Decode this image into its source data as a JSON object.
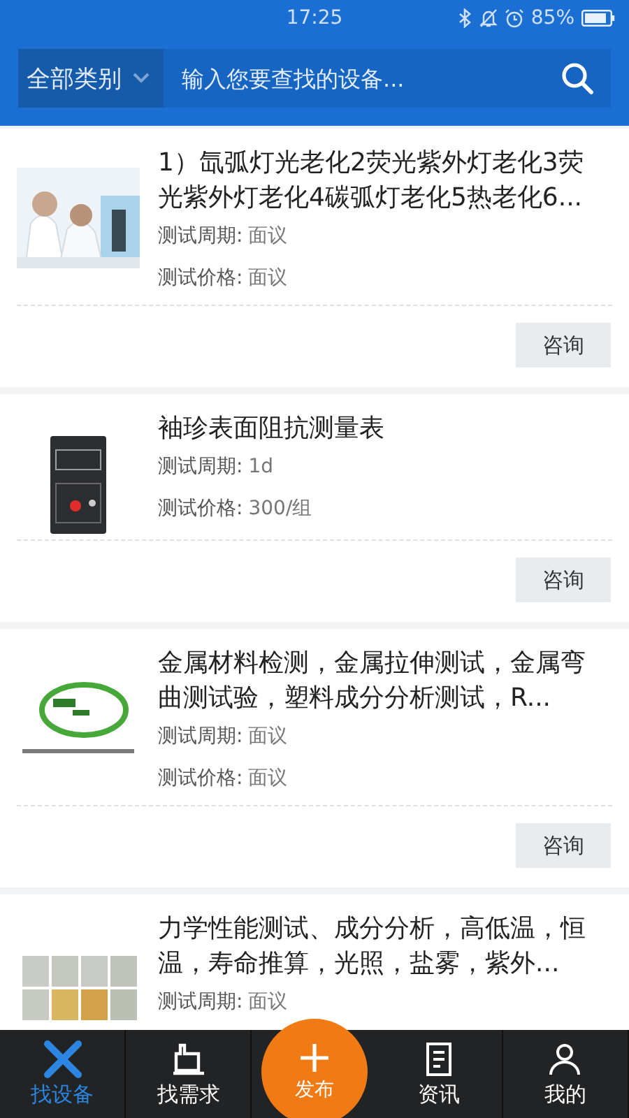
{
  "status_bar": {
    "time": "17:25",
    "battery": "85%"
  },
  "search": {
    "category": "全部类别",
    "placeholder": "输入您要查找的设备..."
  },
  "items": [
    {
      "title": "1）氙弧灯光老化2荧光紫外灯老化3荧光紫外灯老化4碳弧灯老化5热老化6...",
      "meta": [
        {
          "label": "测试周期:",
          "value": "面议"
        },
        {
          "label": "测试价格:",
          "value": "面议"
        }
      ],
      "button": "咨询"
    },
    {
      "title": "袖珍表面阻抗测量表",
      "meta": [
        {
          "label": "测试周期:",
          "value": "1d"
        },
        {
          "label": "测试价格:",
          "value": "300/组"
        }
      ],
      "button": "咨询"
    },
    {
      "title": "金属材料检测，金属拉伸测试，金属弯曲测试验，塑料成分分析测试，R...",
      "meta": [
        {
          "label": "测试周期:",
          "value": "面议"
        },
        {
          "label": "测试价格:",
          "value": "面议"
        }
      ],
      "button": "咨询"
    },
    {
      "title": "力学性能测试、成分分析，高低温，恒温，寿命推算，光照，盐雾，紫外...",
      "meta": [
        {
          "label": "测试周期:",
          "value": "面议"
        }
      ]
    }
  ],
  "nav": [
    {
      "kind": "tab",
      "label": "找设备",
      "selected": true
    },
    {
      "kind": "tab",
      "label": "找需求",
      "selected": false
    },
    {
      "kind": "publish",
      "label": "发布",
      "selected": false
    },
    {
      "kind": "tab",
      "label": "资讯",
      "selected": false
    },
    {
      "kind": "tab",
      "label": "我的",
      "selected": false
    }
  ]
}
